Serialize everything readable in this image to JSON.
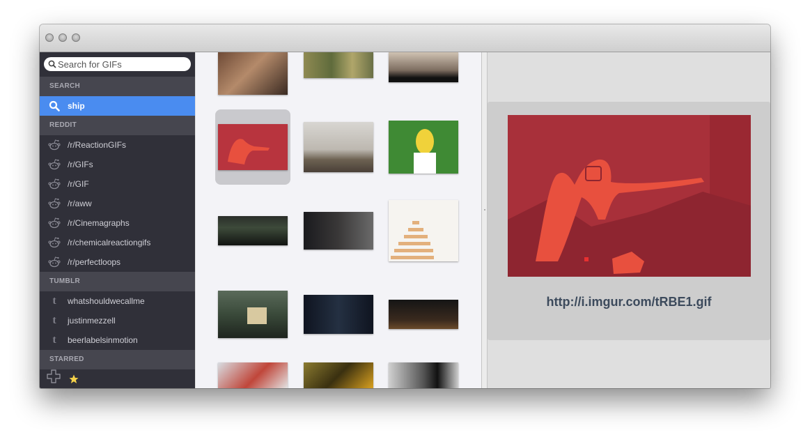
{
  "search": {
    "placeholder": "Search for GIFs"
  },
  "sidebar": {
    "sections": {
      "search": "SEARCH",
      "reddit": "REDDIT",
      "tumblr": "TUMBLR",
      "starred": "STARRED"
    },
    "search_items": [
      {
        "label": "ship",
        "icon": "search-icon",
        "selected": true
      }
    ],
    "reddit_items": [
      {
        "label": "/r/ReactionGIFs",
        "icon": "reddit-alien-icon"
      },
      {
        "label": "/r/GIFs",
        "icon": "reddit-alien-icon"
      },
      {
        "label": "/r/GIF",
        "icon": "reddit-alien-icon"
      },
      {
        "label": "/r/aww",
        "icon": "reddit-alien-icon"
      },
      {
        "label": "/r/Cinemagraphs",
        "icon": "reddit-alien-icon"
      },
      {
        "label": "/r/chemicalreactiongifs",
        "icon": "reddit-alien-icon"
      },
      {
        "label": "/r/perfectloops",
        "icon": "reddit-alien-icon"
      }
    ],
    "tumblr_items": [
      {
        "label": "whatshouldwecallme",
        "icon": "tumblr-icon"
      },
      {
        "label": "justinmezzell",
        "icon": "tumblr-icon"
      },
      {
        "label": "beerlabelsinmotion",
        "icon": "tumblr-icon"
      }
    ],
    "starred": {
      "add_icon": "plus-icon",
      "star_icon": "star-icon",
      "star_color": "#f5d24a"
    }
  },
  "colors": {
    "selection_blue": "#4a8cf0",
    "sidebar_bg": "#303039",
    "preview_red": "#a8303a"
  },
  "preview": {
    "url": "http://i.imgur.com/tRBE1.gif"
  }
}
